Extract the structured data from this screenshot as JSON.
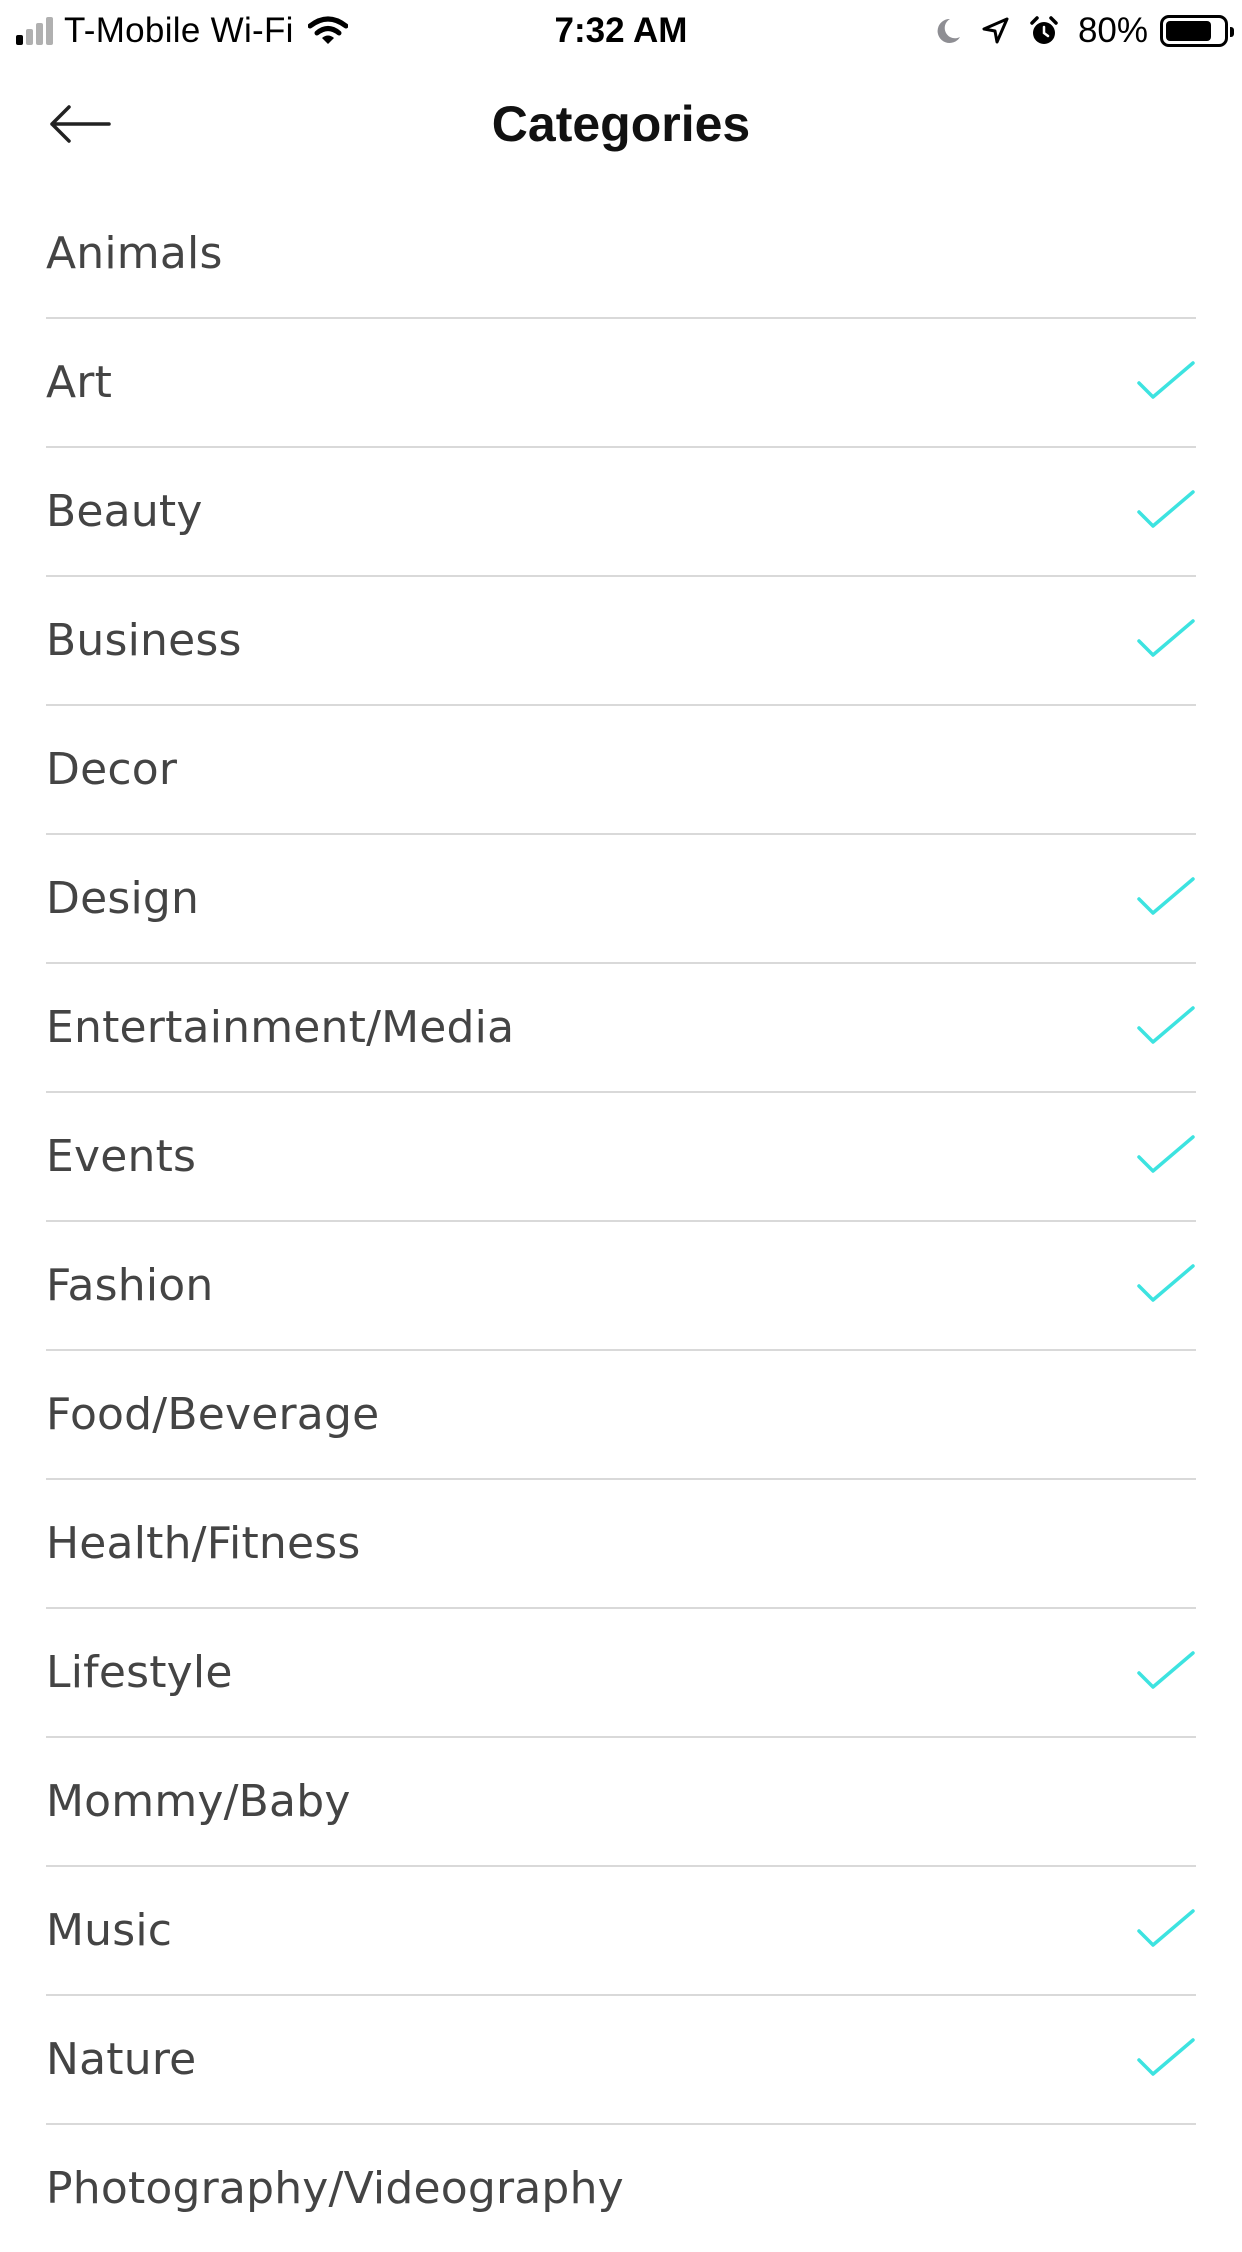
{
  "status_bar": {
    "carrier": "T-Mobile Wi-Fi",
    "time": "7:32 AM",
    "battery_percent": "80%",
    "battery_level": 0.8,
    "signal_bars_active": 1,
    "signal_bars_total": 4,
    "icons": [
      "signal-icon",
      "wifi-icon",
      "moon-icon",
      "location-icon",
      "alarm-icon",
      "battery-icon"
    ]
  },
  "nav": {
    "title": "Categories",
    "back_icon": "arrow-left-icon"
  },
  "colors": {
    "check": "#3de3e0",
    "label": "#444444",
    "divider": "#d9d9d9",
    "background": "#ffffff"
  },
  "categories": [
    {
      "label": "Animals",
      "selected": false
    },
    {
      "label": "Art",
      "selected": true
    },
    {
      "label": "Beauty",
      "selected": true
    },
    {
      "label": "Business",
      "selected": true
    },
    {
      "label": "Decor",
      "selected": false
    },
    {
      "label": "Design",
      "selected": true
    },
    {
      "label": "Entertainment/Media",
      "selected": true
    },
    {
      "label": "Events",
      "selected": true
    },
    {
      "label": "Fashion",
      "selected": true
    },
    {
      "label": "Food/Beverage",
      "selected": false
    },
    {
      "label": "Health/Fitness",
      "selected": false
    },
    {
      "label": "Lifestyle",
      "selected": true
    },
    {
      "label": "Mommy/Baby",
      "selected": false
    },
    {
      "label": "Music",
      "selected": true
    },
    {
      "label": "Nature",
      "selected": true
    },
    {
      "label": "Photography/Videography",
      "selected": false
    }
  ]
}
